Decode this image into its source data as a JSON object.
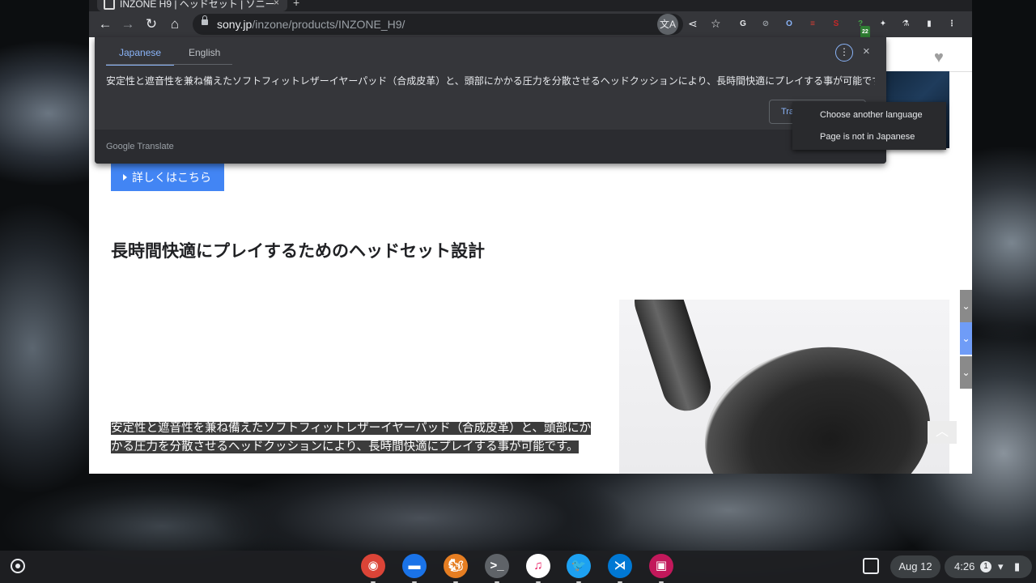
{
  "browser": {
    "tab_title": "INZONE H9 | ヘッドセット | ソニー",
    "tab_close": "×",
    "new_tab": "+",
    "url_host": "sony.jp",
    "url_path": "/inzone/products/INZONE_H9/",
    "nav": {
      "back": "←",
      "forward": "→",
      "reload": "↻",
      "home": "⌂"
    },
    "omnibox_actions": {
      "translate": "文A",
      "share": "⋖",
      "bookmark": "☆"
    },
    "extensions": [
      {
        "name": "grammar-extension",
        "label": "G",
        "color": "#e8eaed"
      },
      {
        "name": "block-extension",
        "label": "⊘",
        "color": "#9aa0a6"
      },
      {
        "name": "privacy-extension",
        "label": "O",
        "color": "#8ab4f8"
      },
      {
        "name": "todoist-extension",
        "label": "≡",
        "color": "#db4035"
      },
      {
        "name": "sentry-extension",
        "label": "S",
        "color": "#c62828"
      },
      {
        "name": "tracker-extension",
        "label": "?",
        "color": "#43a047",
        "badge": "22"
      },
      {
        "name": "extensions-puzzle",
        "label": "✦",
        "color": "#e8eaed"
      },
      {
        "name": "labs-extension",
        "label": "⚗",
        "color": "#e8eaed"
      },
      {
        "name": "side-panel",
        "label": "▮",
        "color": "#e8eaed"
      },
      {
        "name": "browser-menu",
        "label": "⋮",
        "color": "#e8eaed"
      }
    ]
  },
  "translate": {
    "tabs": [
      "Japanese",
      "English"
    ],
    "menu_icon": "⋮",
    "close_icon": "×",
    "text": "安定性と遮音性を兼ね備えたソフトフィットレザーイヤーパッド（合成皮革）と、頭部にかかる圧力を分散させるヘッドクッションにより、長時間快適にプレイする事が可能です。",
    "full_page_button": "Translate full page",
    "brand": "Google Translate",
    "menu_items": [
      "Choose another language",
      "Page is not in Japanese"
    ]
  },
  "page": {
    "more_button": "詳しくはこちら",
    "section_heading": "長時間快適にプレイするためのヘッドセット設計",
    "description": "安定性と遮音性を兼ね備えたソフトフィットレザーイヤーパッド（合成皮革）と、頭部にかかる圧力を分散させるヘッドクッションにより、長時間快適にプレイする事が可能です。",
    "heart_icon": "♥",
    "scroll_top_icon": "︿",
    "side_tabs": [
      "⌄",
      "⌄",
      "⌄"
    ]
  },
  "shelf": {
    "apps": [
      {
        "name": "chrome-app",
        "label": "◉",
        "color": "#db4437"
      },
      {
        "name": "files-app",
        "label": "▬",
        "color": "#1a73e8"
      },
      {
        "name": "squirrel-app",
        "label": "🐿",
        "color": "#e67e22"
      },
      {
        "name": "terminal-app",
        "label": ">_",
        "color": "#5f6368"
      },
      {
        "name": "music-app",
        "label": "♫",
        "color": "#ffffff"
      },
      {
        "name": "twitter-app",
        "label": "🐦",
        "color": "#1da1f2"
      },
      {
        "name": "vscode-app",
        "label": "⋊",
        "color": "#0078d4"
      },
      {
        "name": "photos-app",
        "label": "▣",
        "color": "#c2185b"
      }
    ],
    "date": "Aug 12",
    "time": "4:26",
    "notif_count": "1",
    "wifi": "▾",
    "battery": "▮"
  }
}
